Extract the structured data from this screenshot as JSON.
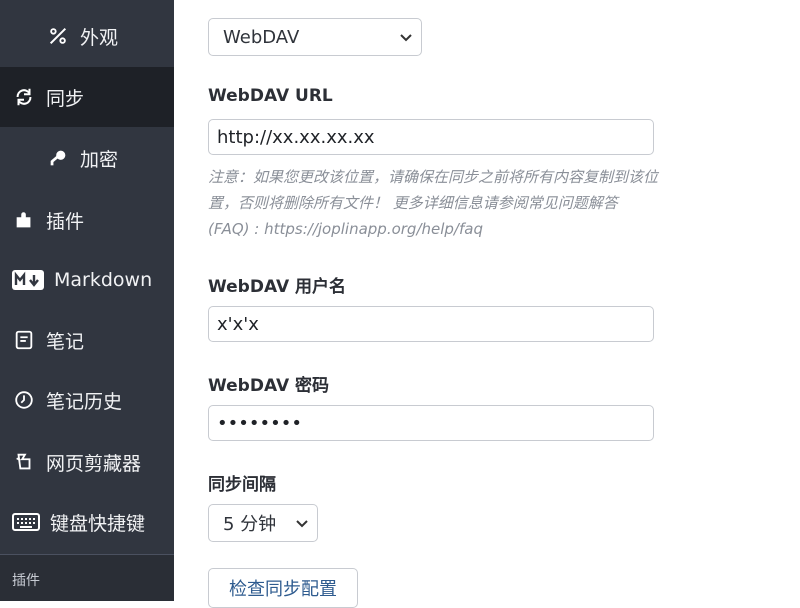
{
  "sidebar": {
    "items": [
      {
        "label": "外观",
        "icon": "appearance-icon"
      },
      {
        "label": "同步",
        "icon": "sync-icon",
        "active": true
      },
      {
        "label": "加密",
        "icon": "key-icon"
      },
      {
        "label": "插件",
        "icon": "puzzle-icon"
      },
      {
        "label": "Markdown",
        "icon": "markdown-icon"
      },
      {
        "label": "笔记",
        "icon": "note-icon"
      },
      {
        "label": "笔记历史",
        "icon": "history-icon"
      },
      {
        "label": "网页剪藏器",
        "icon": "web-clipper-icon"
      },
      {
        "label": "键盘快捷键",
        "icon": "keyboard-icon"
      }
    ],
    "section_label": "插件"
  },
  "sync": {
    "target_value": "WebDAV",
    "url_label": "WebDAV URL",
    "url_value": "http://xx.xx.xx.xx",
    "note": "注意：如果您更改该位置，请确保在同步之前将所有内容复制到该位置，否则将删除所有文件！ 更多详细信息请参阅常见问题解答 (FAQ) : https://joplinapp.org/help/faq",
    "username_label": "WebDAV 用户名",
    "username_value": "x'x'x",
    "password_label": "WebDAV 密码",
    "password_value": "••••••••",
    "interval_label": "同步间隔",
    "interval_value": "5 分钟",
    "check_button_label": "检查同步配置"
  }
}
